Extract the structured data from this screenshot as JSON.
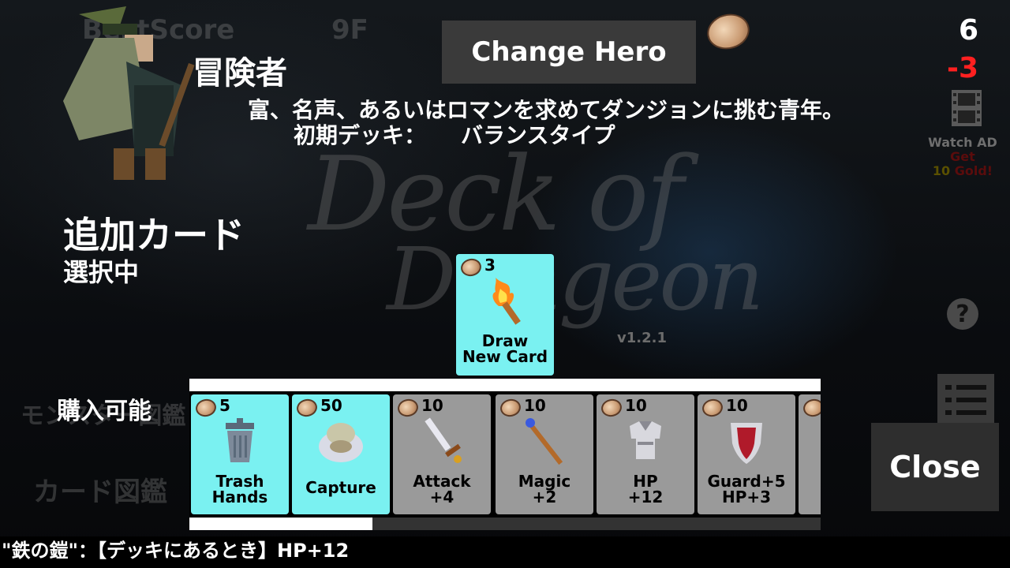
{
  "background": {
    "logo_line1": "Deck of",
    "logo_line2": "Dungeon",
    "version": "v1.2.1",
    "ghost_best_score": "BestScore",
    "ghost_floor": "9F",
    "ghost_monster_book": "モンスター図鑑",
    "ghost_card_book": "カード図鑑"
  },
  "hero": {
    "name": "冒険者",
    "description": "富、名声、あるいはロマンを求めてダンジョンに挑む青年。",
    "deck_label": "初期デッキ：",
    "deck_type": "バランスタイプ",
    "sprite_icon": "adventurer-sprite"
  },
  "header": {
    "change_hero_label": "Change Hero",
    "gold": "6",
    "gold_delta": "-3"
  },
  "ad": {
    "line1": "Watch AD",
    "line2": "Get",
    "line3_num": "10",
    "line3_text": "Gold!"
  },
  "add_card": {
    "title": "追加カード",
    "status": "選択中",
    "selected": {
      "cost": "3",
      "label_1": "Draw",
      "label_2": "New Card",
      "icon": "torch-icon"
    }
  },
  "shop": {
    "label": "購入可能",
    "cards": [
      {
        "cost": "5",
        "label_1": "Trash",
        "label_2": "Hands",
        "icon": "trash-can-icon",
        "affordable": true
      },
      {
        "cost": "50",
        "label_1": "Capture",
        "label_2": "",
        "icon": "capture-bag-icon",
        "affordable": true
      },
      {
        "cost": "10",
        "label_1": "Attack",
        "label_2": "+4",
        "icon": "sword-icon",
        "affordable": false
      },
      {
        "cost": "10",
        "label_1": "Magic",
        "label_2": "+2",
        "icon": "staff-icon",
        "affordable": false
      },
      {
        "cost": "10",
        "label_1": "HP",
        "label_2": "+12",
        "icon": "armor-icon",
        "affordable": false
      },
      {
        "cost": "10",
        "label_1": "Guard+5",
        "label_2": "HP+3",
        "icon": "shield-icon",
        "affordable": false
      },
      {
        "cost": "",
        "label_1": "",
        "label_2": "",
        "icon": "partial-card",
        "affordable": false
      }
    ],
    "scroll_position": 0.29
  },
  "close_label": "Close",
  "help_symbol": "?",
  "footer": {
    "description": "\"鉄の鎧\"：【デッキにあるとき】HP+12"
  },
  "colors": {
    "affordable_card": "#7af1f1",
    "unaffordable_card": "#9a9a9a",
    "delta_red": "#ff2020"
  }
}
